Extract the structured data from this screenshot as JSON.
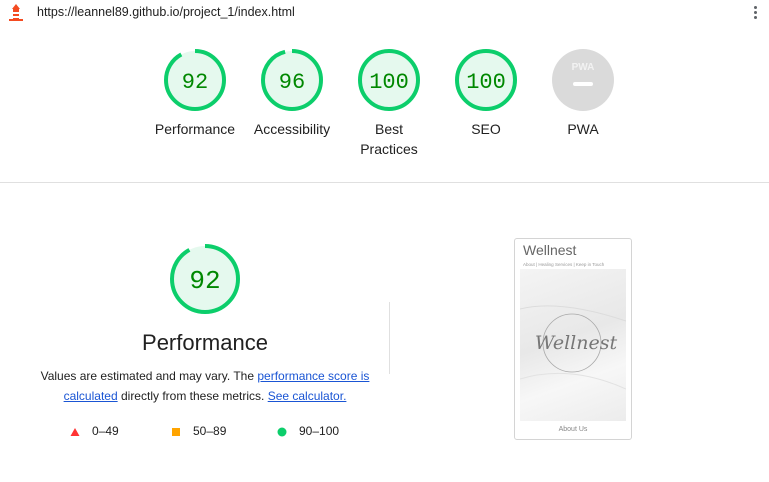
{
  "browser": {
    "url": "https://leannel89.github.io/project_1/index.html"
  },
  "colors": {
    "pass": "#0cce6b",
    "pass_text": "#008800",
    "pass_bg": "#e5f9ee",
    "average": "#ffa400",
    "fail": "#ff3333",
    "na": "#cccccc"
  },
  "gauges": [
    {
      "score": "92",
      "label": "Performance",
      "fraction": 0.92
    },
    {
      "score": "96",
      "label": "Accessibility",
      "fraction": 0.96
    },
    {
      "score": "100",
      "label": "Best Practices",
      "fraction": 1.0
    },
    {
      "score": "100",
      "label": "SEO",
      "fraction": 1.0
    },
    {
      "score": "",
      "label": "PWA",
      "badge": "PWA"
    }
  ],
  "performance": {
    "score": "92",
    "fraction": 0.92,
    "title": "Performance",
    "desc_before": "Values are estimated and may vary. The ",
    "link_score": "performance score is calculated",
    "desc_middle": " directly from these metrics. ",
    "link_calc": "See calculator.",
    "legend": [
      {
        "icon": "triangle-icon",
        "range": "0–49"
      },
      {
        "icon": "square-icon",
        "range": "50–89"
      },
      {
        "icon": "circle-icon",
        "range": "90–100"
      }
    ]
  },
  "screenshot": {
    "title": "Wellnest",
    "nav": "About | Healing Services | Keep in Touch",
    "logo_script": "Wellnest",
    "footer": "About Us"
  }
}
